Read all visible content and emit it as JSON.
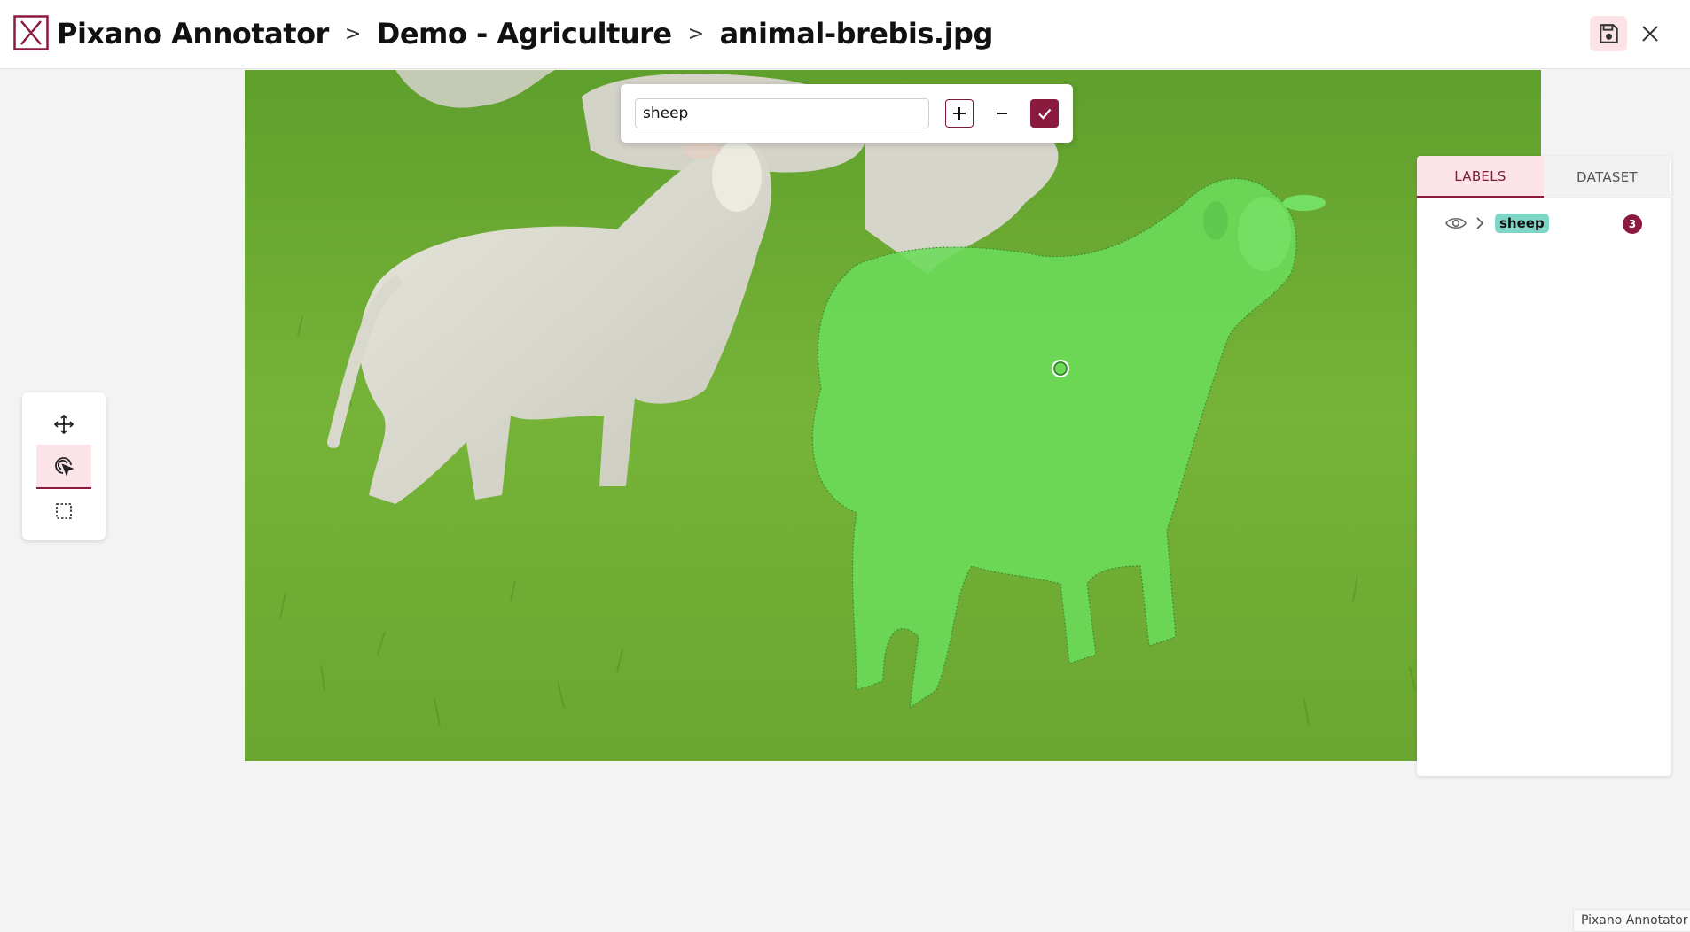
{
  "app": {
    "title": "Pixano Annotator"
  },
  "breadcrumb": {
    "dataset": "Demo - Agriculture",
    "item": "animal-brebis.jpg"
  },
  "header_icons": {
    "save": "save-icon",
    "close": "close-icon"
  },
  "label_popup": {
    "input_value": "sheep",
    "plus_icon": "plus-icon",
    "minus_icon": "minus-icon",
    "confirm_icon": "check-icon"
  },
  "tools": [
    {
      "name": "pan-tool",
      "icon": "move-icon",
      "active": false
    },
    {
      "name": "smart-segmentation-tool",
      "icon": "pointer-target-icon",
      "active": true
    },
    {
      "name": "rectangle-tool",
      "icon": "dashed-rectangle-icon",
      "active": false
    }
  ],
  "panel": {
    "tabs": [
      {
        "label": "LABELS",
        "active": true
      },
      {
        "label": "DATASET",
        "active": false
      }
    ],
    "labels": [
      {
        "name": "sheep",
        "count": "3",
        "color": "#7fd6c7"
      }
    ]
  },
  "colors": {
    "accent": "#8a1a3e",
    "accent_light": "#fbe3e8",
    "mask": "#6bdc5a"
  },
  "footer": {
    "text": "Pixano Annotator"
  }
}
